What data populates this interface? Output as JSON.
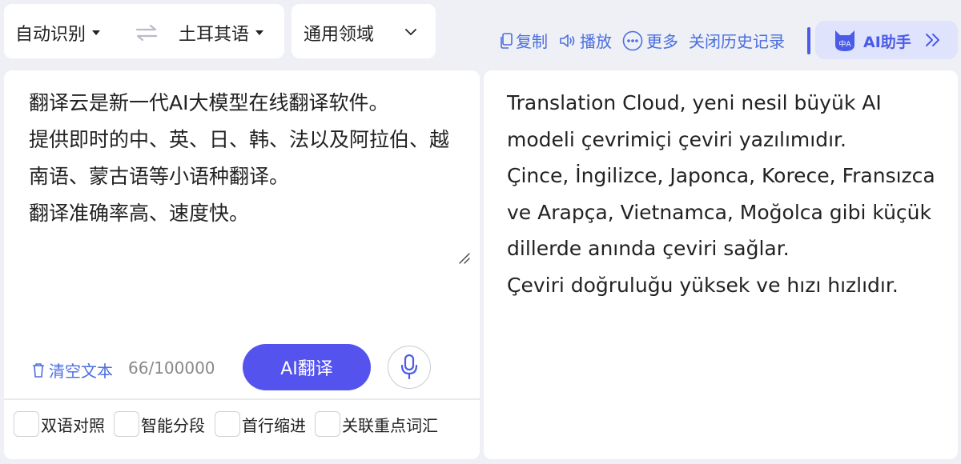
{
  "lang_bar": {
    "source_lang": "自动识别",
    "target_lang": "土耳其语",
    "domain": "通用领域"
  },
  "toolbar": {
    "copy_label": "复制",
    "play_label": "播放",
    "more_label": "更多",
    "history_label": "关闭历史记录",
    "ai_assistant_label": "AI助手",
    "ai_avatar_text": "中A"
  },
  "source": {
    "text": "翻译云是新一代AI大模型在线翻译软件。\n提供即时的中、英、日、韩、法以及阿拉伯、越南语、蒙古语等小语种翻译。\n翻译准确率高、速度快。",
    "clear_label": "清空文本",
    "char_count": "66/100000",
    "translate_label": "AI翻译"
  },
  "options": [
    {
      "label": "双语对照",
      "checked": false
    },
    {
      "label": "智能分段",
      "checked": false
    },
    {
      "label": "首行缩进",
      "checked": false
    },
    {
      "label": "关联重点词汇",
      "checked": false
    }
  ],
  "target": {
    "text": "Translation Cloud, yeni nesil büyük AI modeli çevrimiçi çeviri yazılımıdır.\nÇince, İngilizce, Japonca, Korece, Fransızca ve Arapça, Vietnamca, Moğolca gibi küçük dillerde anında çeviri sağlar.\nÇeviri doğruluğu yüksek ve hızı hızlıdır."
  },
  "colors": {
    "accent": "#5553ee",
    "link": "#4a6ee0",
    "assistant_bg": "#dfe3fb",
    "page_bg": "#eef0f5"
  }
}
